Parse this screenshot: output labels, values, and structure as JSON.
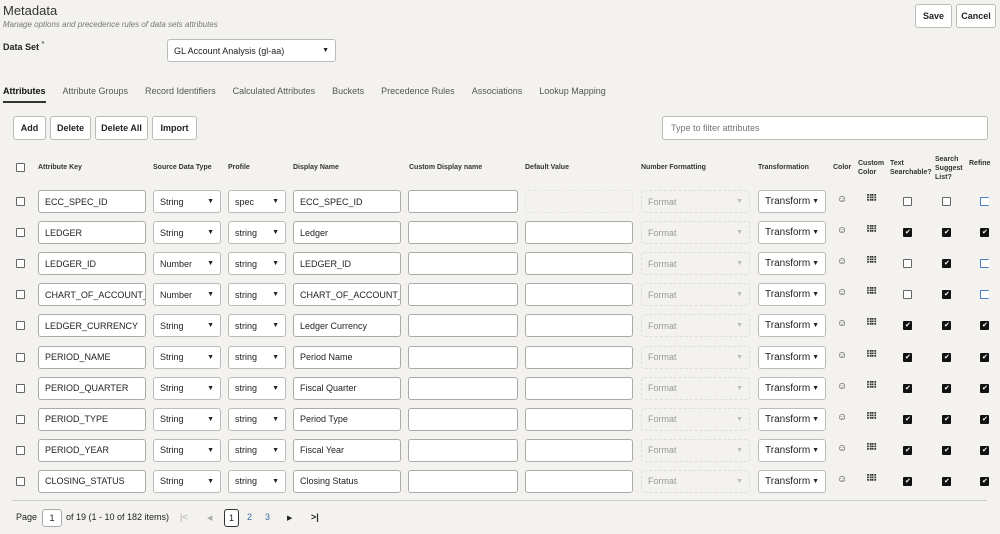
{
  "header": {
    "title": "Metadata",
    "subtitle": "Manage options and precedence rules of data sets attributes",
    "save": "Save",
    "cancel": "Cancel"
  },
  "dataset": {
    "label": "Data Set",
    "required": "*",
    "value": "GL Account Analysis (gl-aa)"
  },
  "tabs": [
    "Attributes",
    "Attribute Groups",
    "Record Identifiers",
    "Calculated Attributes",
    "Buckets",
    "Precedence Rules",
    "Associations",
    "Lookup Mapping"
  ],
  "toolbar": {
    "add": "Add",
    "delete": "Delete",
    "delete_all": "Delete All",
    "import": "Import",
    "filter_placeholder": "Type to filter attributes"
  },
  "columns": [
    "Attribute Key",
    "Source Data Type",
    "Profile",
    "Display Name",
    "Custom Display name",
    "Default Value",
    "Number Formatting",
    "Transformation",
    "Color",
    "Custom Color",
    "Text Searchable?",
    "Search Suggest List?",
    "Refine"
  ],
  "format_placeholder": "Format",
  "transform_label": "Transform",
  "rows": [
    {
      "key": "ECC_SPEC_ID",
      "type": "String",
      "profile": "spec",
      "display": "ECC_SPEC_ID",
      "text": false,
      "suggest": false,
      "refine": false
    },
    {
      "key": "LEDGER",
      "type": "String",
      "profile": "string",
      "display": "Ledger",
      "text": true,
      "suggest": true,
      "refine": true
    },
    {
      "key": "LEDGER_ID",
      "type": "Number",
      "profile": "string",
      "display": "LEDGER_ID",
      "text": false,
      "suggest": true,
      "refine": false
    },
    {
      "key": "CHART_OF_ACCOUNT_II",
      "type": "Number",
      "profile": "string",
      "display": "CHART_OF_ACCOUNT_II",
      "text": false,
      "suggest": true,
      "refine": false
    },
    {
      "key": "LEDGER_CURRENCY",
      "type": "String",
      "profile": "string",
      "display": "Ledger Currency",
      "text": true,
      "suggest": true,
      "refine": true
    },
    {
      "key": "PERIOD_NAME",
      "type": "String",
      "profile": "string",
      "display": "Period Name",
      "text": true,
      "suggest": true,
      "refine": true
    },
    {
      "key": "PERIOD_QUARTER",
      "type": "String",
      "profile": "string",
      "display": "Fiscal Quarter",
      "text": true,
      "suggest": true,
      "refine": true
    },
    {
      "key": "PERIOD_TYPE",
      "type": "String",
      "profile": "string",
      "display": "Period Type",
      "text": true,
      "suggest": true,
      "refine": true
    },
    {
      "key": "PERIOD_YEAR",
      "type": "String",
      "profile": "string",
      "display": "Fiscal Year",
      "text": true,
      "suggest": true,
      "refine": true
    },
    {
      "key": "CLOSING_STATUS",
      "type": "String",
      "profile": "string",
      "display": "Closing Status",
      "text": true,
      "suggest": true,
      "refine": true
    }
  ],
  "pagination": {
    "label": "Page",
    "current": "1",
    "summary": "of 19 (1 - 10 of 182 items)",
    "pages": [
      "1",
      "2",
      "3"
    ]
  }
}
